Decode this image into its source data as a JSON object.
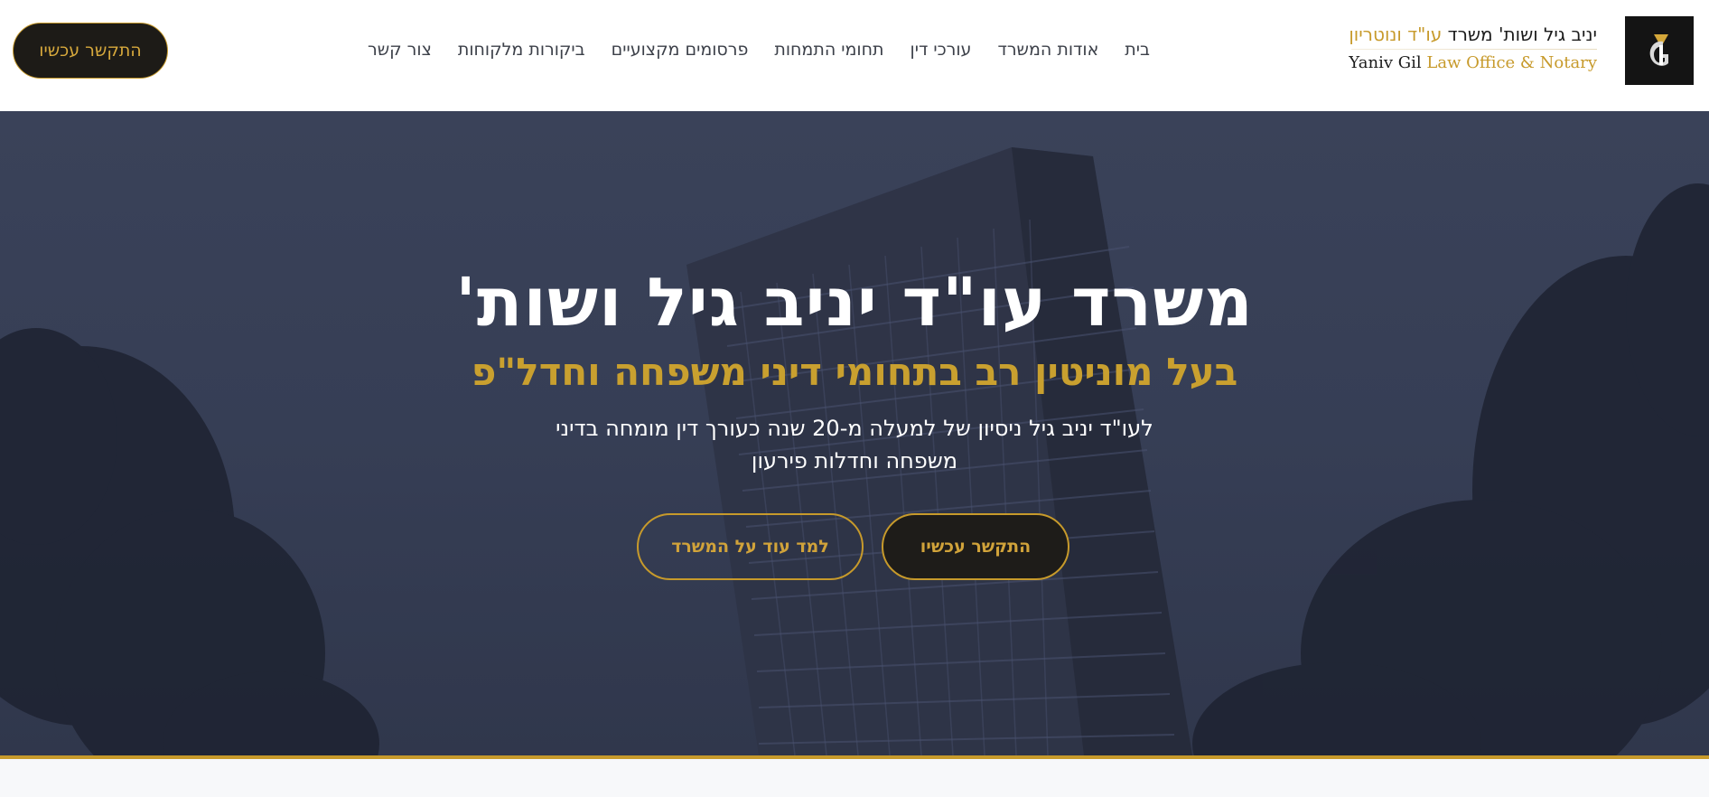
{
  "colors": {
    "accent_gold": "#c79a2b",
    "dark": "#1d1b17",
    "hero_overlay": "#363e55",
    "nav_text": "#3c4049"
  },
  "header": {
    "cta_label": "התקשר עכשיו",
    "nav": [
      {
        "label": "בית"
      },
      {
        "label": "אודות המשרד"
      },
      {
        "label": "עורכי דין"
      },
      {
        "label": "תחומי התמחות"
      },
      {
        "label": "פרסומים מקצועיים"
      },
      {
        "label": "ביקורות מלקוחות"
      },
      {
        "label": "צור קשר"
      }
    ],
    "brand": {
      "line1_dark": "יניב גיל ושות' משרד",
      "line1_gold": "עו\"ד ונוטריון",
      "line2_dark": "Yaniv Gil",
      "line2_gold": "Law Office & Notary"
    },
    "logo_icon": "yg-monogram-icon"
  },
  "hero": {
    "title": "משרד עו\"ד יניב גיל ושות'",
    "subtitle": "בעל מוניטין רב בתחומי דיני משפחה וחדל\"פ",
    "description": "לעו\"ד יניב גיל ניסיון של למעלה מ-20 שנה כעורך דין מומחה בדיני משפחה וחדלות פירעון",
    "primary_button": "התקשר עכשיו",
    "secondary_button": "למד עוד על המשרד",
    "scroll_icon": "arrow-down-icon"
  }
}
